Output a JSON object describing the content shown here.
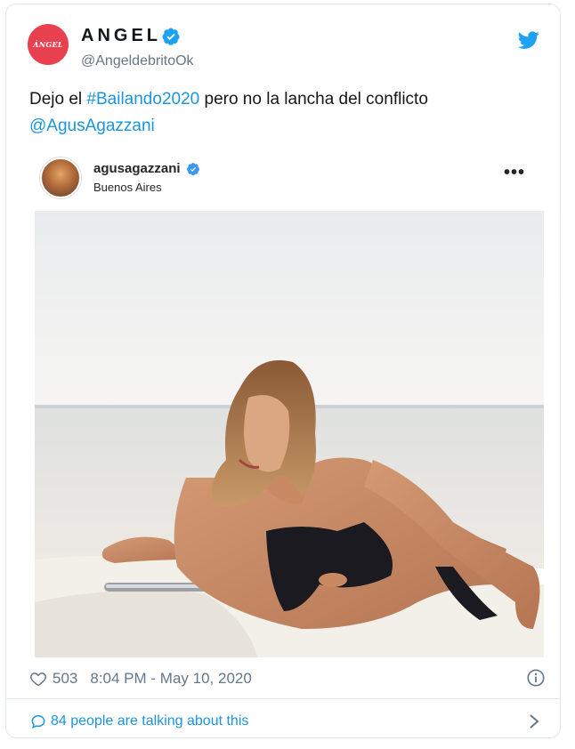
{
  "header": {
    "avatar_text": "ÁNGEL",
    "display_name": "ANGEL",
    "handle": "@AngeldebritoOk"
  },
  "tweet": {
    "text_prefix": "Dejo el ",
    "hashtag": "#Bailando2020",
    "text_middle": " pero no la lancha del conflicto",
    "mention": "@AgusAgazzani"
  },
  "embed": {
    "username": "agusagazzani",
    "location": "Buenos Aires",
    "more_label": "•••"
  },
  "footer": {
    "likes": "503",
    "timestamp": "8:04 PM - May 10, 2020",
    "talking": "84 people are talking about this"
  },
  "colors": {
    "link": "#1b95e0",
    "avatar_bg": "#e8404e",
    "muted": "#657786",
    "border": "#e1e8ed"
  },
  "icons": [
    "verified-icon",
    "twitter-logo-icon",
    "more-icon",
    "heart-icon",
    "info-icon",
    "comment-bubble-icon",
    "chevron-right-icon"
  ]
}
